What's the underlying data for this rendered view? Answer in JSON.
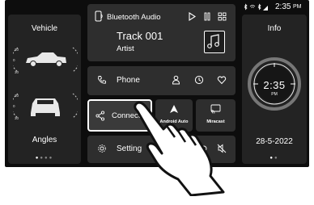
{
  "status_bar": {
    "time": "2:35",
    "time_suffix": "PM"
  },
  "left_panel": {
    "title": "Vehicle",
    "footer": "Angles",
    "scale_top": [
      "30",
      "30",
      "30"
    ],
    "scale_bottom": [
      "30",
      "30",
      "30"
    ]
  },
  "audio": {
    "source": "Bluetooth Audio",
    "track": "Track 001",
    "artist": "Artist"
  },
  "phone": {
    "label": "Phone"
  },
  "connect": {
    "label": "Connect"
  },
  "android_auto": {
    "label": "Android Auto"
  },
  "miracast": {
    "label": "Miracast"
  },
  "setting": {
    "label": "Setting"
  },
  "right_panel": {
    "title": "Info",
    "clock_time": "2:35",
    "clock_suffix": "PM",
    "date": "28-5-2022"
  }
}
